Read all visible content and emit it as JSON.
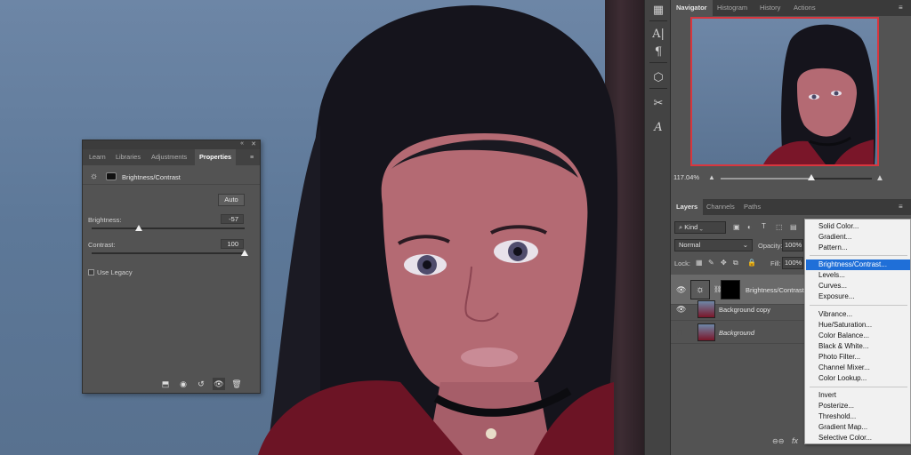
{
  "toolstrip": {
    "tools": [
      "grid-icon",
      "type-icon",
      "paragraph-icon",
      "cube-icon",
      "tools-icon",
      "glyph-icon"
    ]
  },
  "navigator": {
    "tabs": [
      "Navigator",
      "Histogram",
      "History",
      "Actions"
    ],
    "zoom": "117.04%",
    "zoom_level": 0.6
  },
  "layers": {
    "tabs": [
      "Layers",
      "Channels",
      "Paths"
    ],
    "filter_kind": "Kind",
    "blend_mode": "Normal",
    "opacity_label": "Opacity:",
    "opacity_value": "100%",
    "lock_label": "Lock:",
    "fill_label": "Fill:",
    "fill_value": "100%",
    "items": [
      {
        "name": "Brightness/Contrast",
        "selected": true
      },
      {
        "name": "Background copy",
        "selected": false
      },
      {
        "name": "Background",
        "selected": false
      }
    ]
  },
  "adjustment_menu": {
    "group1": [
      "Solid Color...",
      "Gradient...",
      "Pattern..."
    ],
    "group2": [
      "Brightness/Contrast...",
      "Levels...",
      "Curves...",
      "Exposure..."
    ],
    "group3": [
      "Vibrance...",
      "Hue/Saturation...",
      "Color Balance...",
      "Black & White...",
      "Photo Filter...",
      "Channel Mixer...",
      "Color Lookup..."
    ],
    "group4": [
      "Invert",
      "Posterize...",
      "Threshold...",
      "Gradient Map...",
      "Selective Color..."
    ],
    "highlighted": "Brightness/Contrast..."
  },
  "properties": {
    "tabs": [
      "Learn",
      "Libraries",
      "Adjustments",
      "Properties"
    ],
    "title": "Brightness/Contrast",
    "auto_label": "Auto",
    "brightness_label": "Brightness:",
    "brightness_value": "-57",
    "brightness_level": 0.31,
    "contrast_label": "Contrast:",
    "contrast_value": "100",
    "contrast_level": 1.0,
    "legacy_label": "Use Legacy"
  },
  "colors": {
    "menu_highlight": "#1f6fd8",
    "navigator_frame": "#d8363e",
    "panel_bg": "#535353"
  }
}
